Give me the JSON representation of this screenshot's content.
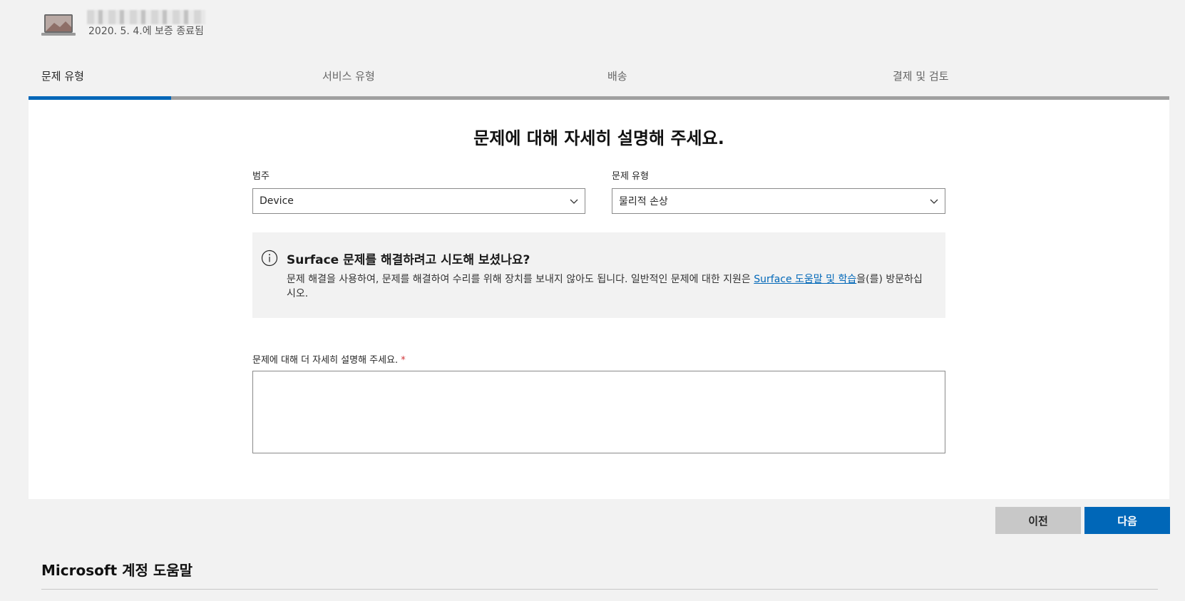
{
  "device": {
    "warranty_text": "2020. 5. 4.에 보증 종료됨"
  },
  "steps": [
    {
      "label": "문제 유형"
    },
    {
      "label": "서비스 유형"
    },
    {
      "label": "배송"
    },
    {
      "label": "결제 및 검토"
    }
  ],
  "progress": {
    "current_step": 1,
    "total_steps": 4
  },
  "form": {
    "heading": "문제에 대해 자세히 설명해 주세요.",
    "category_label": "범주",
    "category_value": "Device",
    "issue_type_label": "문제 유형",
    "issue_type_value": "물리적 손상",
    "notice": {
      "title": "Surface 문제를 해결하려고 시도해 보셨나요?",
      "body_before_link": "문제 해결을 사용하여, 문제를 해결하여 수리를 위해 장치를 보내지 않아도 됩니다. 일반적인 문제에 대한 지원은 ",
      "link_text": "Surface 도움말 및 학습",
      "body_after_link": "을(를) 방문하십시오."
    },
    "description_label": "문제에 대해 더 자세히 설명해 주세요.",
    "description_required_mark": "*",
    "description_value": ""
  },
  "buttons": {
    "previous": "이전",
    "next": "다음"
  },
  "footer": {
    "title": "Microsoft 계정 도움말"
  },
  "colors": {
    "accent": "#0067b8",
    "required": "#d13438"
  }
}
